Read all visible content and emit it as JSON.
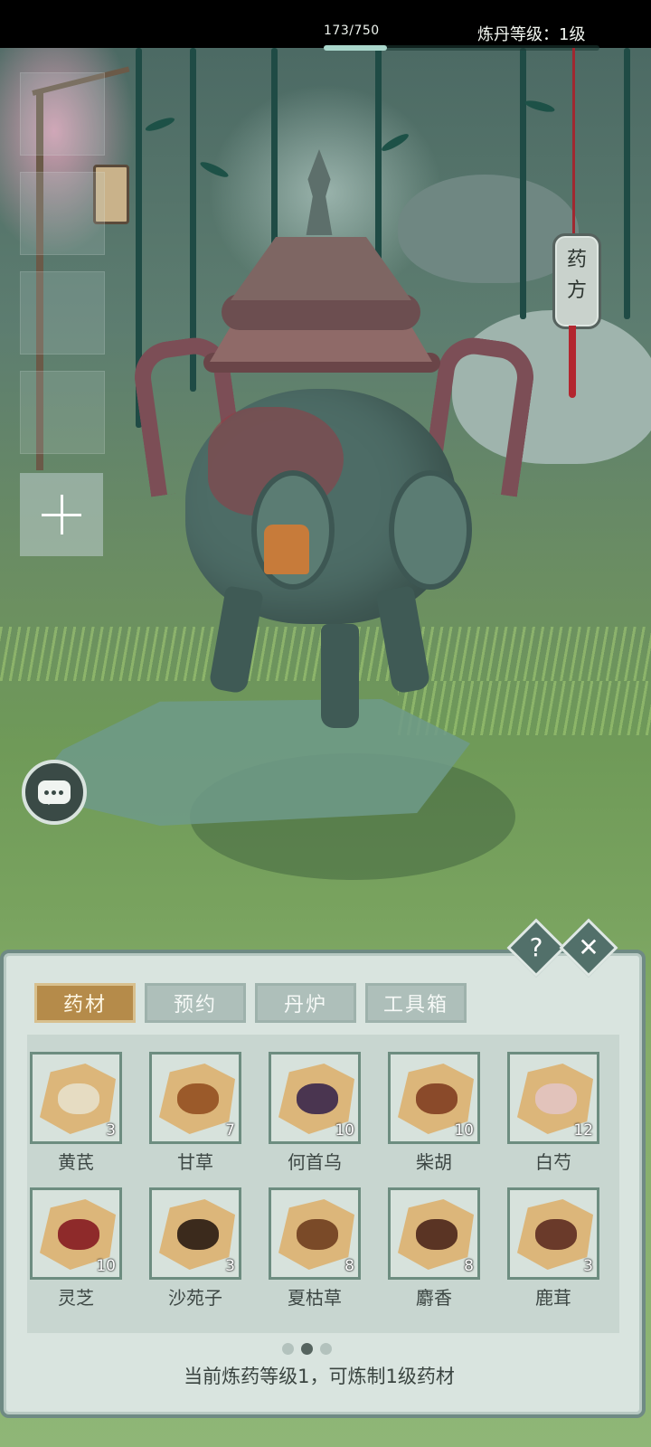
{
  "header": {
    "exp_text": "173/750",
    "exp_progress": 0.23,
    "level_text": "炼丹等级：1级"
  },
  "recipe_tag": {
    "label_line1": "药",
    "label_line2": "方"
  },
  "panel": {
    "help_label": "?",
    "close_label": "✕",
    "tabs": [
      {
        "label": "药材",
        "active": true
      },
      {
        "label": "预约",
        "active": false
      },
      {
        "label": "丹炉",
        "active": false
      },
      {
        "label": "工具箱",
        "active": false
      }
    ],
    "items": [
      {
        "name": "黄芪",
        "count": "3",
        "color": "#e6dcc2"
      },
      {
        "name": "甘草",
        "count": "7",
        "color": "#9b5a2a"
      },
      {
        "name": "何首乌",
        "count": "10",
        "color": "#4a3550"
      },
      {
        "name": "柴胡",
        "count": "10",
        "color": "#8a4a2a"
      },
      {
        "name": "白芍",
        "count": "12",
        "color": "#e2c3bb"
      },
      {
        "name": "灵芝",
        "count": "10",
        "color": "#8e2a2a"
      },
      {
        "name": "沙苑子",
        "count": "3",
        "color": "#3b2a1c"
      },
      {
        "name": "夏枯草",
        "count": "8",
        "color": "#7a4a28"
      },
      {
        "name": "麝香",
        "count": "8",
        "color": "#5a3424"
      },
      {
        "name": "鹿茸",
        "count": "3",
        "color": "#6a3a2a"
      }
    ],
    "page_dots": 3,
    "current_page": 1,
    "hint": "当前炼药等级1，可炼制1级药材"
  }
}
